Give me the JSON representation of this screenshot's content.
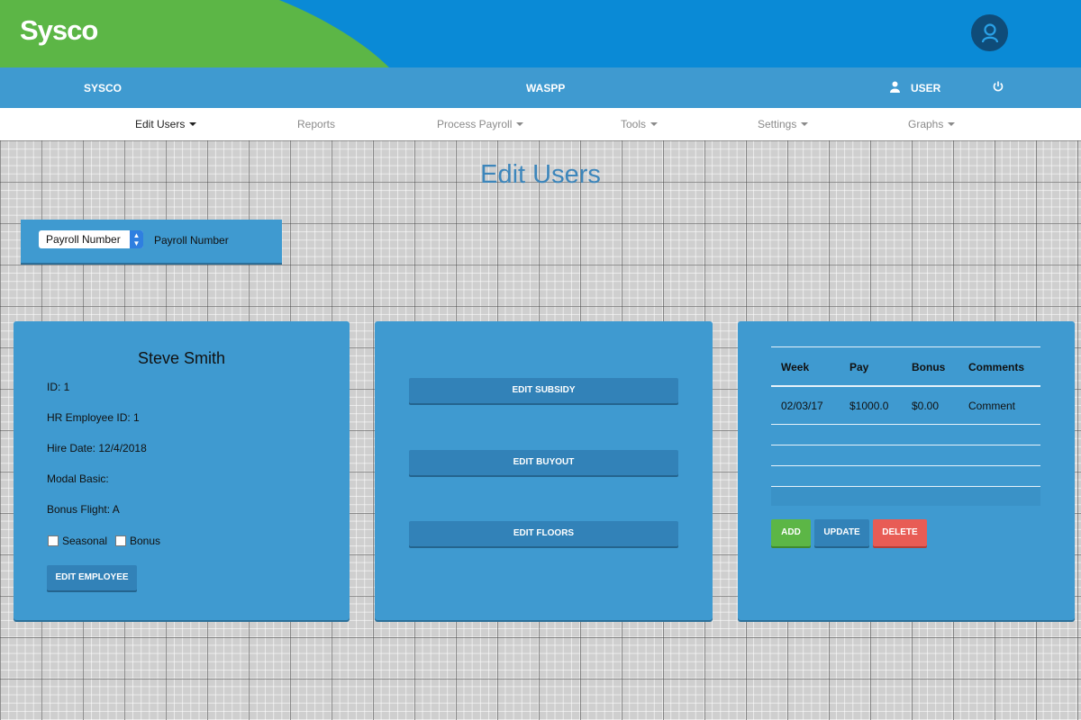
{
  "brand": {
    "logo_text": "Sysco",
    "green": "#5cb646",
    "blue": "#0a8ad6",
    "accent": "#3f9ad0"
  },
  "navbar": {
    "left": "SYSCO",
    "center": "WASPP",
    "user": "USER"
  },
  "menu": [
    {
      "label": "Edit Users",
      "dropdown": true,
      "active": true
    },
    {
      "label": "Reports",
      "dropdown": false
    },
    {
      "label": "Process Payroll",
      "dropdown": true
    },
    {
      "label": "Tools",
      "dropdown": true
    },
    {
      "label": "Settings",
      "dropdown": true
    },
    {
      "label": "Graphs",
      "dropdown": true
    }
  ],
  "page": {
    "title": "Edit Users"
  },
  "search": {
    "select_value": "Payroll Number",
    "label": "Payroll Number"
  },
  "employee": {
    "name": "Steve Smith",
    "id": "ID: 1",
    "hr_id": "HR Employee ID: 1",
    "hire_date": "Hire Date: 12/4/2018",
    "modal_basic": "Modal Basic:",
    "bonus_flight": "Bonus Flight: A",
    "seasonal_label": "Seasonal",
    "bonus_label": "Bonus",
    "seasonal_checked": false,
    "bonus_checked": false,
    "edit_button": "EDIT EMPLOYEE"
  },
  "actions": {
    "edit_subsidy": "EDIT SUBSIDY",
    "edit_buyout": "EDIT BUYOUT",
    "edit_floors": "EDIT FLOORS"
  },
  "payroll_table": {
    "columns": [
      "Week",
      "Pay",
      "Bonus",
      "Comments"
    ],
    "rows": [
      [
        "02/03/17",
        "$1000.0",
        "$0.00",
        "Comment"
      ]
    ],
    "add": "ADD",
    "update": "UPDATE",
    "delete": "DELETE",
    "add_color": "#5cb646",
    "update_color": "#3282b8",
    "delete_color": "#e85c55"
  }
}
